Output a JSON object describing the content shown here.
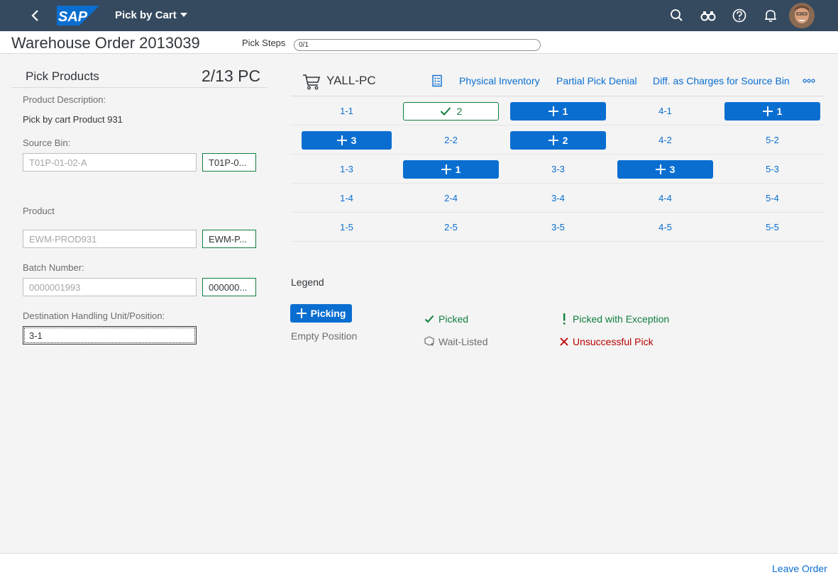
{
  "shell": {
    "app_title": "Pick by Cart",
    "logo_text": "SAP",
    "icons": [
      "back-icon",
      "search-icon",
      "binoculars-icon",
      "help-icon",
      "bell-icon"
    ],
    "colors": {
      "bar": "#354a5f",
      "logo": "#0a6ed1"
    }
  },
  "header": {
    "title": "Warehouse Order 2013039",
    "pick_steps_label": "Pick Steps",
    "pick_steps_value": "0/1",
    "pick_steps_progress": 0
  },
  "left": {
    "title": "Pick Products",
    "quantity": "2/13 PC",
    "product_description_label": "Product Description:",
    "product_description": "Pick by cart Product 931",
    "source_bin_label": "Source Bin:",
    "source_bin_placeholder": "T01P-01-02-A",
    "source_bin_value": "T01P-0...",
    "product_label": "Product",
    "product_placeholder": "EWM-PROD931",
    "product_value": "EWM-P...",
    "batch_label": "Batch Number:",
    "batch_placeholder": "0000001993",
    "batch_value": "000000...",
    "dest_label": "Destination Handling Unit/Position:",
    "dest_value": "3-1"
  },
  "right": {
    "cart_name": "YALL-PC",
    "toolbar": {
      "physical_inventory": "Physical Inventory",
      "partial_pick_denial": "Partial Pick Denial",
      "diff_charges": "Diff. as Charges for Source Bin"
    },
    "grid": [
      [
        {
          "type": "label",
          "text": "1-1"
        },
        {
          "type": "picked",
          "text": "2"
        },
        {
          "type": "pick",
          "text": "1"
        },
        {
          "type": "label",
          "text": "4-1"
        },
        {
          "type": "pick",
          "text": "1"
        }
      ],
      [
        {
          "type": "pick",
          "text": "3"
        },
        {
          "type": "label",
          "text": "2-2"
        },
        {
          "type": "pick",
          "text": "2"
        },
        {
          "type": "label",
          "text": "4-2"
        },
        {
          "type": "label",
          "text": "5-2"
        }
      ],
      [
        {
          "type": "label",
          "text": "1-3"
        },
        {
          "type": "pick",
          "text": "1"
        },
        {
          "type": "label",
          "text": "3-3"
        },
        {
          "type": "pick",
          "text": "3"
        },
        {
          "type": "label",
          "text": "5-3"
        }
      ],
      [
        {
          "type": "label",
          "text": "1-4"
        },
        {
          "type": "label",
          "text": "2-4"
        },
        {
          "type": "label",
          "text": "3-4"
        },
        {
          "type": "label",
          "text": "4-4"
        },
        {
          "type": "label",
          "text": "5-4"
        }
      ],
      [
        {
          "type": "label",
          "text": "1-5"
        },
        {
          "type": "label",
          "text": "2-5"
        },
        {
          "type": "label",
          "text": "3-5"
        },
        {
          "type": "label",
          "text": "4-5"
        },
        {
          "type": "label",
          "text": "5-5"
        }
      ]
    ]
  },
  "legend": {
    "title": "Legend",
    "picking": "Picking",
    "empty_position": "Empty Position",
    "picked": "Picked",
    "wait_listed": "Wait-Listed",
    "picked_with_exception": "Picked with Exception",
    "unsuccessful_pick": "Unsuccessful Pick",
    "colors": {
      "picked": "#107e3e",
      "wait_listed": "#6a6d70",
      "unsuccessful": "#bb0000",
      "picking": "#0a6ed1"
    }
  },
  "footer": {
    "leave_order": "Leave Order"
  }
}
